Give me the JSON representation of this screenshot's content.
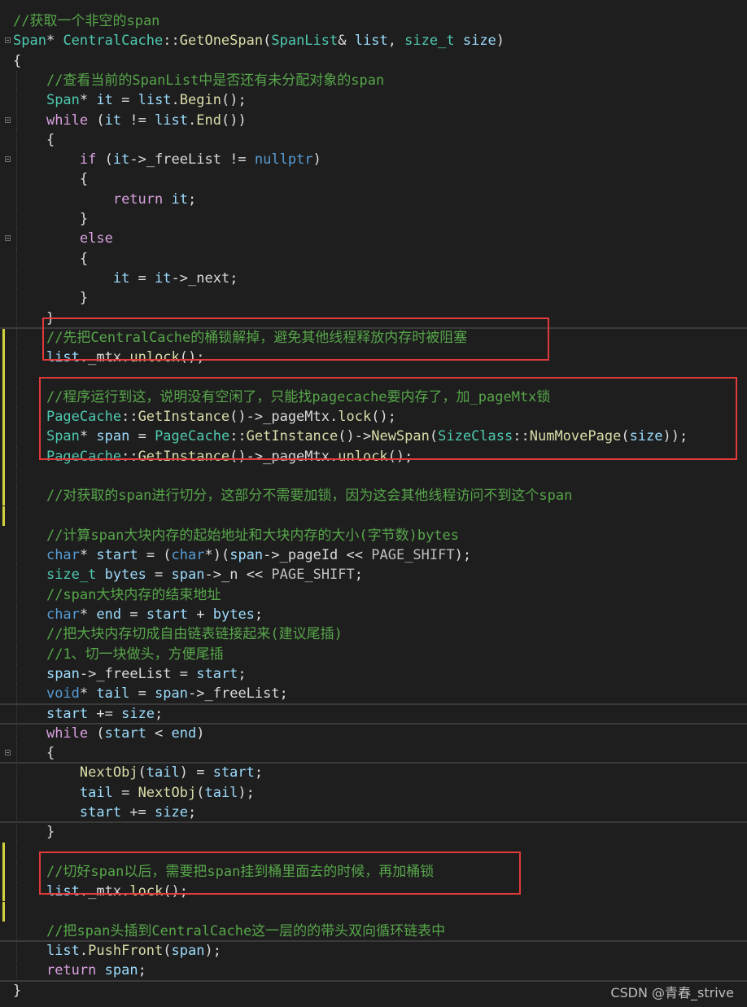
{
  "code_lines": [
    [
      {
        "t": "//获取一个非空的span",
        "c": "comment"
      }
    ],
    [
      {
        "t": "Span",
        "c": "type"
      },
      {
        "t": "* ",
        "c": "plain"
      },
      {
        "t": "CentralCache",
        "c": "type"
      },
      {
        "t": "::",
        "c": "plain"
      },
      {
        "t": "GetOneSpan",
        "c": "func"
      },
      {
        "t": "(",
        "c": "plain"
      },
      {
        "t": "SpanList",
        "c": "type"
      },
      {
        "t": "& ",
        "c": "plain"
      },
      {
        "t": "list",
        "c": "var"
      },
      {
        "t": ", ",
        "c": "plain"
      },
      {
        "t": "size_t",
        "c": "type"
      },
      {
        "t": " ",
        "c": "plain"
      },
      {
        "t": "size",
        "c": "var"
      },
      {
        "t": ")",
        "c": "plain"
      }
    ],
    [
      {
        "t": "{",
        "c": "plain"
      }
    ],
    [
      {
        "t": "    ",
        "c": "plain"
      },
      {
        "t": "//查看当前的SpanList中是否还有未分配对象的span",
        "c": "comment"
      }
    ],
    [
      {
        "t": "    ",
        "c": "plain"
      },
      {
        "t": "Span",
        "c": "type"
      },
      {
        "t": "* ",
        "c": "plain"
      },
      {
        "t": "it",
        "c": "var"
      },
      {
        "t": " = ",
        "c": "plain"
      },
      {
        "t": "list",
        "c": "var"
      },
      {
        "t": ".",
        "c": "plain"
      },
      {
        "t": "Begin",
        "c": "func"
      },
      {
        "t": "();",
        "c": "plain"
      }
    ],
    [
      {
        "t": "    ",
        "c": "plain"
      },
      {
        "t": "while",
        "c": "ctrl"
      },
      {
        "t": " (",
        "c": "plain"
      },
      {
        "t": "it",
        "c": "var"
      },
      {
        "t": " != ",
        "c": "plain"
      },
      {
        "t": "list",
        "c": "var"
      },
      {
        "t": ".",
        "c": "plain"
      },
      {
        "t": "End",
        "c": "func"
      },
      {
        "t": "())",
        "c": "plain"
      }
    ],
    [
      {
        "t": "    {",
        "c": "plain"
      }
    ],
    [
      {
        "t": "        ",
        "c": "plain"
      },
      {
        "t": "if",
        "c": "ctrl"
      },
      {
        "t": " (",
        "c": "plain"
      },
      {
        "t": "it",
        "c": "var"
      },
      {
        "t": "->",
        "c": "plain"
      },
      {
        "t": "_freeList",
        "c": "field"
      },
      {
        "t": " != ",
        "c": "plain"
      },
      {
        "t": "nullptr",
        "c": "keyword"
      },
      {
        "t": ")",
        "c": "plain"
      }
    ],
    [
      {
        "t": "        {",
        "c": "plain"
      }
    ],
    [
      {
        "t": "            ",
        "c": "plain"
      },
      {
        "t": "return",
        "c": "ctrl"
      },
      {
        "t": " ",
        "c": "plain"
      },
      {
        "t": "it",
        "c": "var"
      },
      {
        "t": ";",
        "c": "plain"
      }
    ],
    [
      {
        "t": "        }",
        "c": "plain"
      }
    ],
    [
      {
        "t": "        ",
        "c": "plain"
      },
      {
        "t": "else",
        "c": "ctrl"
      }
    ],
    [
      {
        "t": "        {",
        "c": "plain"
      }
    ],
    [
      {
        "t": "            ",
        "c": "plain"
      },
      {
        "t": "it",
        "c": "var"
      },
      {
        "t": " = ",
        "c": "plain"
      },
      {
        "t": "it",
        "c": "var"
      },
      {
        "t": "->",
        "c": "plain"
      },
      {
        "t": "_next",
        "c": "field"
      },
      {
        "t": ";",
        "c": "plain"
      }
    ],
    [
      {
        "t": "        }",
        "c": "plain"
      }
    ],
    [
      {
        "t": "    }",
        "c": "plain"
      }
    ],
    [
      {
        "t": "    ",
        "c": "plain"
      },
      {
        "t": "//先把CentralCache的桶锁解掉，避免其他线程释放内存时被阻塞",
        "c": "comment"
      }
    ],
    [
      {
        "t": "    ",
        "c": "plain"
      },
      {
        "t": "list",
        "c": "var"
      },
      {
        "t": ".",
        "c": "plain"
      },
      {
        "t": "_mtx",
        "c": "field"
      },
      {
        "t": ".",
        "c": "plain"
      },
      {
        "t": "unlock",
        "c": "func"
      },
      {
        "t": "();",
        "c": "plain"
      }
    ],
    [],
    [
      {
        "t": "    ",
        "c": "plain"
      },
      {
        "t": "//程序运行到这，说明没有空闲了，只能找pagecache要内存了，加_pageMtx锁",
        "c": "comment"
      }
    ],
    [
      {
        "t": "    ",
        "c": "plain"
      },
      {
        "t": "PageCache",
        "c": "type"
      },
      {
        "t": "::",
        "c": "plain"
      },
      {
        "t": "GetInstance",
        "c": "func"
      },
      {
        "t": "()->",
        "c": "plain"
      },
      {
        "t": "_pageMtx",
        "c": "field"
      },
      {
        "t": ".",
        "c": "plain"
      },
      {
        "t": "lock",
        "c": "func"
      },
      {
        "t": "();",
        "c": "plain"
      }
    ],
    [
      {
        "t": "    ",
        "c": "plain"
      },
      {
        "t": "Span",
        "c": "type"
      },
      {
        "t": "* ",
        "c": "plain"
      },
      {
        "t": "span",
        "c": "var"
      },
      {
        "t": " = ",
        "c": "plain"
      },
      {
        "t": "PageCache",
        "c": "type"
      },
      {
        "t": "::",
        "c": "plain"
      },
      {
        "t": "GetInstance",
        "c": "func"
      },
      {
        "t": "()->",
        "c": "plain"
      },
      {
        "t": "NewSpan",
        "c": "func"
      },
      {
        "t": "(",
        "c": "plain"
      },
      {
        "t": "SizeClass",
        "c": "type"
      },
      {
        "t": "::",
        "c": "plain"
      },
      {
        "t": "NumMovePage",
        "c": "func"
      },
      {
        "t": "(",
        "c": "plain"
      },
      {
        "t": "size",
        "c": "var"
      },
      {
        "t": "));",
        "c": "plain"
      }
    ],
    [
      {
        "t": "    ",
        "c": "plain"
      },
      {
        "t": "PageCache",
        "c": "type"
      },
      {
        "t": "::",
        "c": "plain"
      },
      {
        "t": "GetInstance",
        "c": "func"
      },
      {
        "t": "()->",
        "c": "plain"
      },
      {
        "t": "_pageMtx",
        "c": "field"
      },
      {
        "t": ".",
        "c": "plain"
      },
      {
        "t": "unlock",
        "c": "func"
      },
      {
        "t": "();",
        "c": "plain"
      }
    ],
    [],
    [
      {
        "t": "    ",
        "c": "plain"
      },
      {
        "t": "//对获取的span进行切分，这部分不需要加锁，因为这会其他线程访问不到这个span",
        "c": "comment"
      }
    ],
    [],
    [
      {
        "t": "    ",
        "c": "plain"
      },
      {
        "t": "//计算span大块内存的起始地址和大块内存的大小(字节数)bytes",
        "c": "comment"
      }
    ],
    [
      {
        "t": "    ",
        "c": "plain"
      },
      {
        "t": "char",
        "c": "keyword"
      },
      {
        "t": "* ",
        "c": "plain"
      },
      {
        "t": "start",
        "c": "var"
      },
      {
        "t": " = (",
        "c": "plain"
      },
      {
        "t": "char",
        "c": "keyword"
      },
      {
        "t": "*)(",
        "c": "plain"
      },
      {
        "t": "span",
        "c": "var"
      },
      {
        "t": "->",
        "c": "plain"
      },
      {
        "t": "_pageId",
        "c": "field"
      },
      {
        "t": " << ",
        "c": "plain"
      },
      {
        "t": "PAGE_SHIFT",
        "c": "macro"
      },
      {
        "t": ");",
        "c": "plain"
      }
    ],
    [
      {
        "t": "    ",
        "c": "plain"
      },
      {
        "t": "size_t",
        "c": "type"
      },
      {
        "t": " ",
        "c": "plain"
      },
      {
        "t": "bytes",
        "c": "var"
      },
      {
        "t": " = ",
        "c": "plain"
      },
      {
        "t": "span",
        "c": "var"
      },
      {
        "t": "->",
        "c": "plain"
      },
      {
        "t": "_n",
        "c": "field"
      },
      {
        "t": " << ",
        "c": "plain"
      },
      {
        "t": "PAGE_SHIFT",
        "c": "macro"
      },
      {
        "t": ";",
        "c": "plain"
      }
    ],
    [
      {
        "t": "    ",
        "c": "plain"
      },
      {
        "t": "//span大块内存的结束地址",
        "c": "comment"
      }
    ],
    [
      {
        "t": "    ",
        "c": "plain"
      },
      {
        "t": "char",
        "c": "keyword"
      },
      {
        "t": "* ",
        "c": "plain"
      },
      {
        "t": "end",
        "c": "var"
      },
      {
        "t": " = ",
        "c": "plain"
      },
      {
        "t": "start",
        "c": "var"
      },
      {
        "t": " + ",
        "c": "plain"
      },
      {
        "t": "bytes",
        "c": "var"
      },
      {
        "t": ";",
        "c": "plain"
      }
    ],
    [
      {
        "t": "    ",
        "c": "plain"
      },
      {
        "t": "//把大块内存切成自由链表链接起来(建议尾插)",
        "c": "comment"
      }
    ],
    [
      {
        "t": "    ",
        "c": "plain"
      },
      {
        "t": "//1、切一块做头，方便尾插",
        "c": "comment"
      }
    ],
    [
      {
        "t": "    ",
        "c": "plain"
      },
      {
        "t": "span",
        "c": "var"
      },
      {
        "t": "->",
        "c": "plain"
      },
      {
        "t": "_freeList",
        "c": "field"
      },
      {
        "t": " = ",
        "c": "plain"
      },
      {
        "t": "start",
        "c": "var"
      },
      {
        "t": ";",
        "c": "plain"
      }
    ],
    [
      {
        "t": "    ",
        "c": "plain"
      },
      {
        "t": "void",
        "c": "keyword"
      },
      {
        "t": "* ",
        "c": "plain"
      },
      {
        "t": "tail",
        "c": "var"
      },
      {
        "t": " = ",
        "c": "plain"
      },
      {
        "t": "span",
        "c": "var"
      },
      {
        "t": "->",
        "c": "plain"
      },
      {
        "t": "_freeList",
        "c": "field"
      },
      {
        "t": ";",
        "c": "plain"
      }
    ],
    [
      {
        "t": "    ",
        "c": "plain"
      },
      {
        "t": "start",
        "c": "var"
      },
      {
        "t": " += ",
        "c": "plain"
      },
      {
        "t": "size",
        "c": "var"
      },
      {
        "t": ";",
        "c": "plain"
      }
    ],
    [
      {
        "t": "    ",
        "c": "plain"
      },
      {
        "t": "while",
        "c": "ctrl"
      },
      {
        "t": " (",
        "c": "plain"
      },
      {
        "t": "start",
        "c": "var"
      },
      {
        "t": " < ",
        "c": "plain"
      },
      {
        "t": "end",
        "c": "var"
      },
      {
        "t": ")",
        "c": "plain"
      }
    ],
    [
      {
        "t": "    {",
        "c": "plain"
      }
    ],
    [
      {
        "t": "        ",
        "c": "plain"
      },
      {
        "t": "NextObj",
        "c": "func"
      },
      {
        "t": "(",
        "c": "plain"
      },
      {
        "t": "tail",
        "c": "var"
      },
      {
        "t": ") = ",
        "c": "plain"
      },
      {
        "t": "start",
        "c": "var"
      },
      {
        "t": ";",
        "c": "plain"
      }
    ],
    [
      {
        "t": "        ",
        "c": "plain"
      },
      {
        "t": "tail",
        "c": "var"
      },
      {
        "t": " = ",
        "c": "plain"
      },
      {
        "t": "NextObj",
        "c": "func"
      },
      {
        "t": "(",
        "c": "plain"
      },
      {
        "t": "tail",
        "c": "var"
      },
      {
        "t": ");",
        "c": "plain"
      }
    ],
    [
      {
        "t": "        ",
        "c": "plain"
      },
      {
        "t": "start",
        "c": "var"
      },
      {
        "t": " += ",
        "c": "plain"
      },
      {
        "t": "size",
        "c": "var"
      },
      {
        "t": ";",
        "c": "plain"
      }
    ],
    [
      {
        "t": "    }",
        "c": "plain"
      }
    ],
    [],
    [
      {
        "t": "    ",
        "c": "plain"
      },
      {
        "t": "//切好span以后，需要把span挂到桶里面去的时候，再加桶锁",
        "c": "comment"
      }
    ],
    [
      {
        "t": "    ",
        "c": "plain"
      },
      {
        "t": "list",
        "c": "var"
      },
      {
        "t": ".",
        "c": "plain"
      },
      {
        "t": "_mtx",
        "c": "field"
      },
      {
        "t": ".",
        "c": "plain"
      },
      {
        "t": "lock",
        "c": "func"
      },
      {
        "t": "();",
        "c": "plain"
      }
    ],
    [],
    [
      {
        "t": "    ",
        "c": "plain"
      },
      {
        "t": "//把span头插到CentralCache这一层的的带头双向循环链表中",
        "c": "comment"
      }
    ],
    [
      {
        "t": "    ",
        "c": "plain"
      },
      {
        "t": "list",
        "c": "var"
      },
      {
        "t": ".",
        "c": "plain"
      },
      {
        "t": "PushFront",
        "c": "func"
      },
      {
        "t": "(",
        "c": "plain"
      },
      {
        "t": "span",
        "c": "var"
      },
      {
        "t": ");",
        "c": "plain"
      }
    ],
    [
      {
        "t": "    ",
        "c": "plain"
      },
      {
        "t": "return",
        "c": "ctrl"
      },
      {
        "t": " ",
        "c": "plain"
      },
      {
        "t": "span",
        "c": "var"
      },
      {
        "t": ";",
        "c": "plain"
      }
    ],
    [
      {
        "t": "}",
        "c": "plain"
      }
    ]
  ],
  "watermark": "CSDN @青春_strive",
  "colors": {
    "background": "#1e1e1e",
    "comment": "#57a64a",
    "keyword": "#569cd6",
    "control": "#d8a0df",
    "type": "#4ec9b0",
    "function": "#dcdcaa",
    "variable": "#9cdcfe",
    "highlight_box": "#e03a3a",
    "change_marker": "#d2d23f"
  }
}
